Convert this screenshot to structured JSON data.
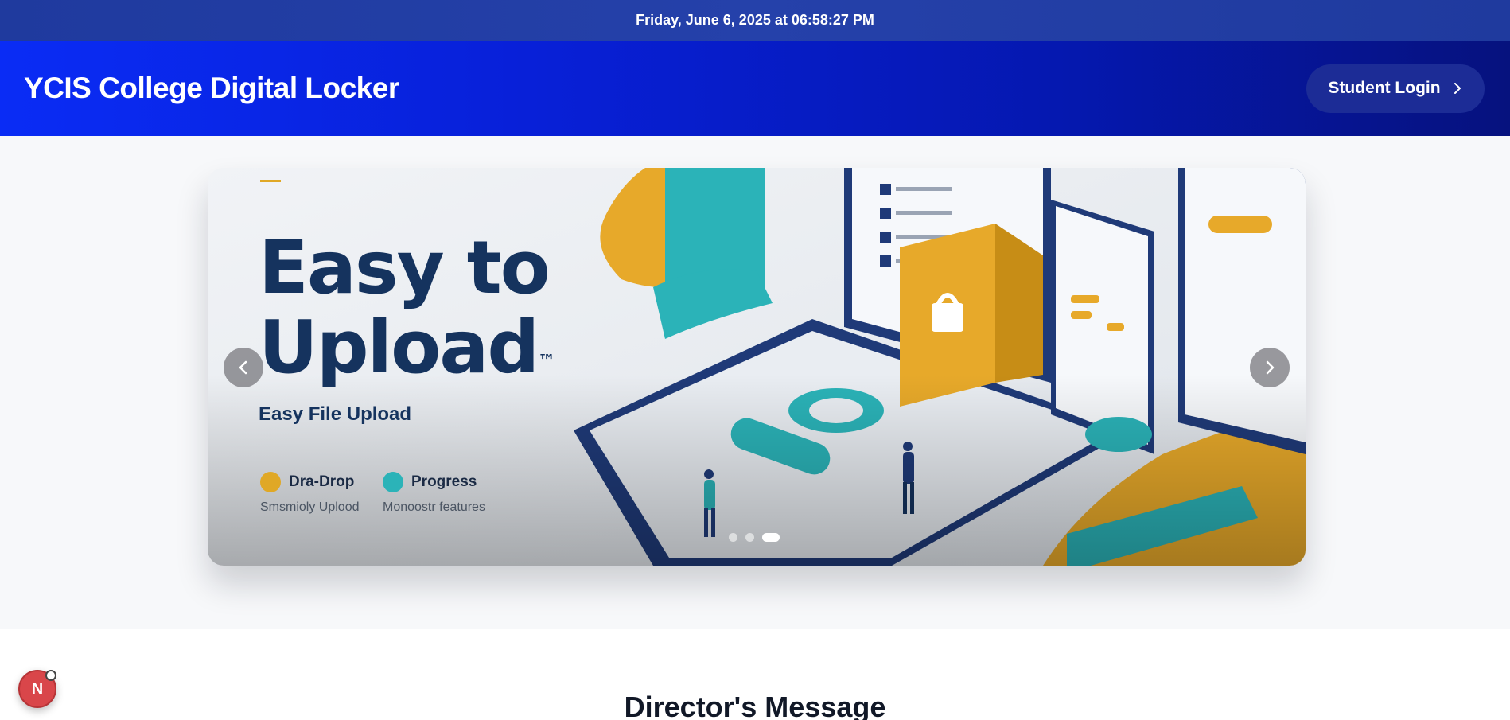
{
  "topbar": {
    "datetime": "Friday, June 6, 2025 at 06:58:27 PM"
  },
  "header": {
    "title": "YCIS College Digital Locker",
    "login_label": "Student Login",
    "login_icon": "chevron-right-icon"
  },
  "carousel": {
    "slide": {
      "heading_line1": "Easy to",
      "heading_line2": "Upload",
      "trademark": "™",
      "subheading": "Easy File Upload",
      "features": [
        {
          "title": "Dra-Drop",
          "desc": "Smsmioly Uplood",
          "icon_color": "#e0a826"
        },
        {
          "title": "Progress",
          "desc": "Monoostr features",
          "icon_color": "#2bb3b8"
        }
      ]
    },
    "prev_icon": "chevron-left-icon",
    "next_icon": "chevron-right-icon",
    "slide_count": 3,
    "active_index": 2
  },
  "director": {
    "title": "Director's Message"
  },
  "badge": {
    "letter": "N"
  },
  "colors": {
    "header_start": "#0a2cf5",
    "header_end": "#06127e",
    "accent_yellow": "#e7a92a",
    "accent_teal": "#2bb3b8",
    "navy": "#15335e"
  }
}
